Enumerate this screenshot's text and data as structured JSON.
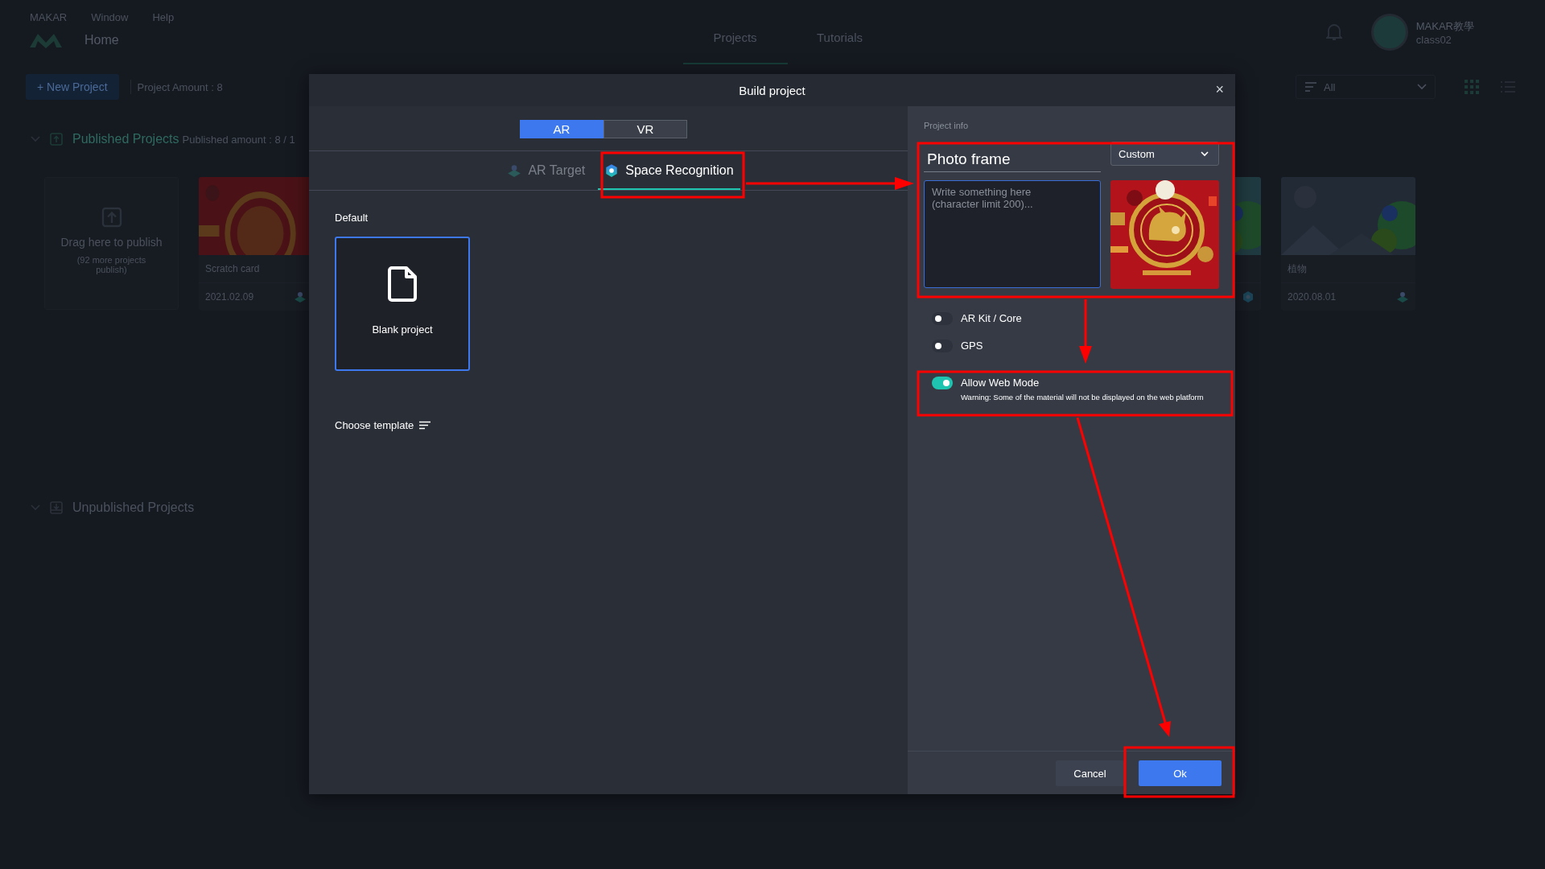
{
  "menu_bar": [
    "MAKAR",
    "Window",
    "Help"
  ],
  "header": {
    "page_title": "Home",
    "tabs": [
      {
        "label": "Projects",
        "selected": true
      },
      {
        "label": "Tutorials",
        "selected": false
      }
    ],
    "user": {
      "name": "MAKAR教學",
      "account": "class02"
    }
  },
  "toolbar": {
    "new_project": "+ New Project",
    "project_amount": "Project Amount : 8",
    "filter": "All"
  },
  "published": {
    "title": "Published Projects",
    "count": "Published amount : 8 / 1",
    "drop_zone": {
      "title": "Drag here to publish",
      "note": "(92 more projects publish)"
    },
    "cards": [
      {
        "kind": "target",
        "title": "Scratch card",
        "date": "2021.02.09"
      },
      {
        "kind": "space"
      },
      {
        "kind": "target",
        "title": "植物",
        "date": "2020.08.01"
      }
    ]
  },
  "unpublished": {
    "title": "Unpublished Projects"
  },
  "dialog": {
    "title": "Build project",
    "close": "×",
    "modes": [
      {
        "label": "AR",
        "selected": true
      },
      {
        "label": "VR",
        "selected": false
      }
    ],
    "types": [
      {
        "label": "AR Target",
        "kind": "target",
        "selected": false
      },
      {
        "label": "Space Recognition",
        "kind": "space",
        "selected": true
      }
    ],
    "default_heading": "Default",
    "templates": [
      {
        "label": "Blank project",
        "selected": true
      }
    ],
    "choose_template": "Choose template",
    "project_info": {
      "heading": "Project info",
      "name": "Photo frame",
      "category": "Custom",
      "description_placeholder": "Write something here (character limit 200)..."
    },
    "options": [
      {
        "label": "AR Kit / Core",
        "on": false
      },
      {
        "label": "GPS",
        "on": false
      },
      {
        "label": "Allow Web Mode",
        "on": true,
        "note": "Warning: Some of the material will not be displayed on the web platform"
      }
    ],
    "buttons": [
      {
        "label": "Cancel",
        "kind": "secondary"
      },
      {
        "label": "Ok",
        "kind": "primary"
      }
    ]
  }
}
